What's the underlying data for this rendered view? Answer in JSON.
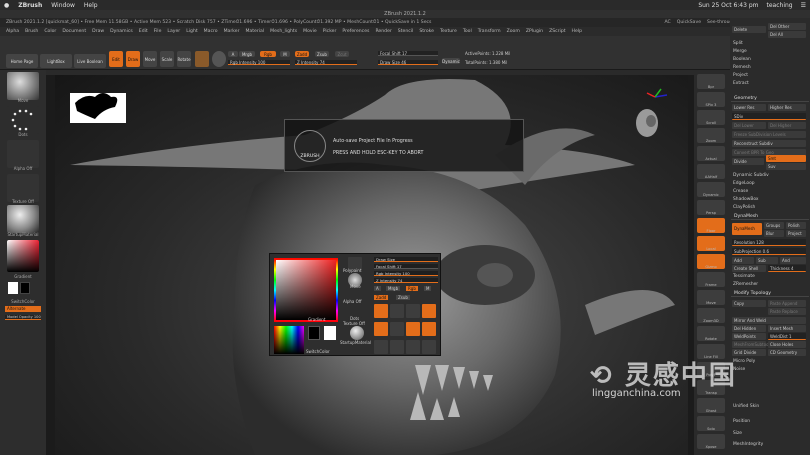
{
  "mac": {
    "apple": "",
    "app": "ZBrush",
    "menu1": "Window",
    "menu2": "Help",
    "datetime": "Sun 25 Oct 6:43 pm",
    "user": "teaching"
  },
  "title": "ZBrush 2021.1.2",
  "info": {
    "left": "ZBrush 2021.1.2 [quickmat_60]  •  Free Mem 11.58GB • Active Mem 523 • Scratch Disk 757 • ZTime⏱1.696 • Timer⏱1.696 • PolyCount⏱1.392 MP • MeshCount⏱1 • QuickSave in 1 Secs",
    "ac": "AC",
    "quicksave": "QuickSave",
    "seethrough": "See-through  0",
    "menus": "Menus",
    "defaultscript": "DefaultZScript"
  },
  "menubar": [
    "Alpha",
    "Brush",
    "Color",
    "Document",
    "Draw",
    "Dynamics",
    "Edit",
    "File",
    "Layer",
    "Light",
    "Macro",
    "Marker",
    "Material",
    "Mesh_lights",
    "Movie",
    "Picker",
    "Preferences",
    "Render",
    "Stencil",
    "Stroke",
    "Texture",
    "Tool",
    "Transform",
    "Zoom",
    "ZPlugin",
    "ZScript",
    "Help"
  ],
  "shelf": {
    "homepage": "Home Page",
    "lightbox": "LightBox",
    "liveboolean": "Live Boolean",
    "edit": "Edit",
    "draw": "Draw",
    "move": "Move",
    "scale": "Scale",
    "rotate": "Rotate",
    "mrgb": "Mrgb",
    "rgb": "Rgb",
    "m": "M",
    "zadd": "Zadd",
    "zsub": "Zsub",
    "zcut": "Zcut",
    "rgb_intensity": "Rgb Intensity 100",
    "z_intensity": "Z Intensity 74",
    "focal_shift": "Focal Shift 17",
    "draw_size": "Draw Size 46",
    "dynamic": "Dynamic",
    "active_points": "ActivePoints: 1.228 Mil",
    "total_points": "TotalPoints: 1.380 Mil"
  },
  "left": {
    "brush": "Move",
    "stroke": "Dots",
    "alpha": "Alpha Off",
    "texture": "Texture Off",
    "material": "StartupMaterial",
    "gradient": "Gradient",
    "switchcolor": "SwitchColor",
    "alternate": "Alternate",
    "mask_opacity": "Model Opacity 100"
  },
  "notice": {
    "logo": "ZBRUSH",
    "line1": "Auto-save Project File In Progress",
    "line2": "PRESS AND HOLD ESC-KEY TO ABORT"
  },
  "popup": {
    "polypaint": "Polypaint",
    "move": "Move",
    "alpha": "Alpha Off",
    "dots": "Dots",
    "texture": "Texture Off",
    "material": "StartupMaterial",
    "gradient": "Gradient",
    "switchcolor": "SwitchColor",
    "draw_size": "Draw Size",
    "focal_shift": "Focal Shift 17",
    "rgb_intensity": "Rgb Intensity 100",
    "z_intensity": "Z Intensity 74",
    "a": "A",
    "mrgb": "Mrgb",
    "rgb": "Rgb",
    "m": "M",
    "zadd": "Zadd",
    "zsub": "Zsub",
    "edit": "Edit",
    "draw": "Draw",
    "move_b": "Move",
    "scale": "Scale",
    "rotate": "Rotate",
    "gizmo": "Gizmo",
    "qgrid": "QGrid"
  },
  "rtray": [
    "Bpr",
    "SPix 3",
    "Scroll",
    "Zoom",
    "Actual",
    "AAHalf",
    "Dynamic",
    "Persp",
    "Floor",
    "Local",
    "Gizmo",
    "Frame",
    "Move",
    "Zoom3D",
    "Rotate",
    "Line Fill",
    "PolyF",
    "Transp",
    "Ghost",
    "Solo",
    "Xpose"
  ],
  "rpal": {
    "delete": "Delete",
    "deloth": "Del Other",
    "delall": "Del All",
    "split": "Split",
    "merge": "Merge",
    "boolean": "Boolean",
    "remesh": "Remesh",
    "project": "Project",
    "extract": "Extract",
    "geometry": "Geometry",
    "lowersubdiv": "Lower Res",
    "highersubdiv": "Higher Res",
    "subdivlvl": "SDiv",
    "delhigher": "Del Higher",
    "dellower": "Del Lower",
    "freeze": "Freeze SubDivision Levels",
    "reconstruct": "Reconstruct Subdiv",
    "convert": "Convert BPR To Geo",
    "divide": "Divide",
    "smt": "Smt",
    "suv": "Suv",
    "dynsub": "Dynamic Subdiv",
    "edgeloop": "EdgeLoop",
    "crease": "Crease",
    "shadowbox": "ShadowBox",
    "claypolish": "ClayPolish",
    "dynamesh": "DynaMesh",
    "dynamesh_btn": "DynaMesh",
    "groups": "Groups",
    "polish": "Polish",
    "blur": "Blur",
    "project_b": "Project",
    "resolution": "Resolution 128",
    "subproj": "SubProjection 0.6",
    "add": "Add",
    "sub": "Sub",
    "and": "And",
    "createshell": "Create Shell",
    "thickness": "Thickness 4",
    "zremesher": "ZRemesher",
    "tessimate": "Tessimate",
    "modtopo": "Modify Topology",
    "copy": "Copy",
    "pasteappend": "Paste Append",
    "pastereplace": "Paste Replace",
    "mirrorweld": "Mirror And Weld",
    "delhidden": "Del Hidden",
    "insertmesh": "Insert Mesh",
    "weldpoints": "WeldPoints",
    "weldDist": "WeldDist 1",
    "meshfromsubtool": "MeshFromSubtool",
    "closeholes": "Close Holes",
    "gridcivide": "Grid Divide",
    "cgeometry": "CD Geometry",
    "micropoly": "Micro Poly",
    "noise": "Noise",
    "spotlight": "Spotlight",
    "mp": "Position",
    "size": "Size",
    "unified": "Unified Skin",
    "msheet": "MeshIntegrity"
  }
}
